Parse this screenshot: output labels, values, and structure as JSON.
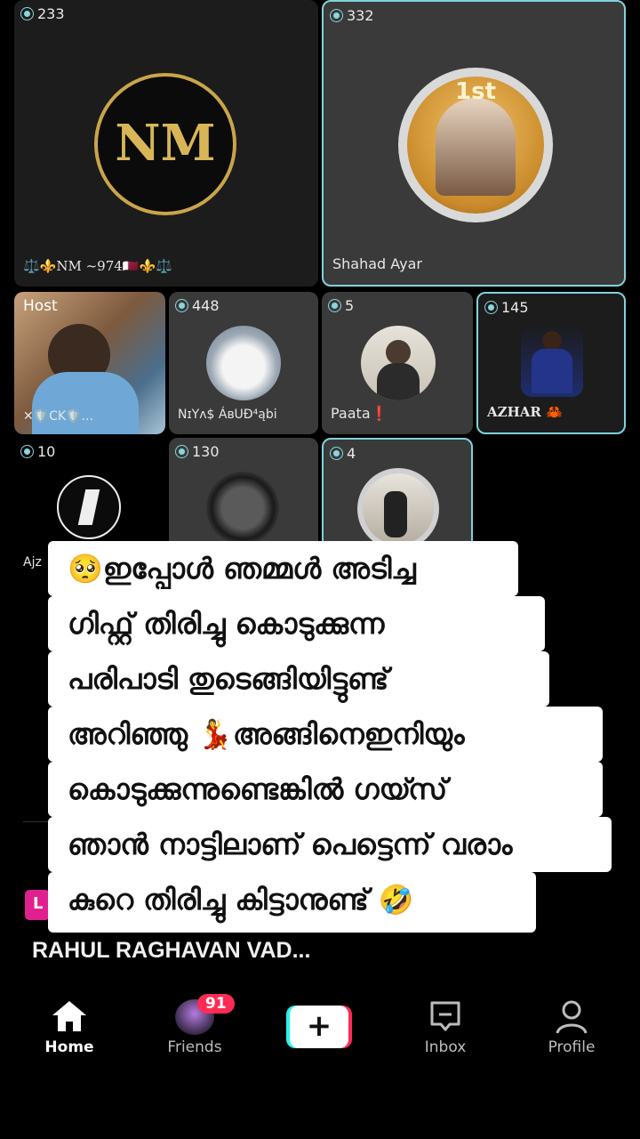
{
  "tiles": [
    {
      "count": "233",
      "name": "⚖️⚜️NM ~974🇶🇦⚜️⚖️",
      "logo_text": "NM"
    },
    {
      "count": "332",
      "name": "Shahad Ayar",
      "frame_text": "1st"
    },
    {
      "host_label": "Host",
      "name": "✕🛡️CK🛡️..."
    },
    {
      "count": "448",
      "name": "NɪYᴧ$ ÁʙUĐ⁴ąbi"
    },
    {
      "count": "5",
      "name": "Paata❗"
    },
    {
      "count": "145",
      "name": "AZHAR 🦀"
    },
    {
      "count": "10",
      "name": "Ajz"
    },
    {
      "count": "130"
    },
    {
      "count": "4"
    }
  ],
  "caption_lines": [
    "🥺ഇപ്പോൾ ഞമ്മൾ അടിച്ച",
    "ഗിഫ്റ്റ് തിരിച്ചു കൊടുക്കുന്ന",
    "പരിപാടി തുടെങ്ങിയിട്ടുണ്ട്",
    "അറിഞ്ഞു 💃അങ്ങിനെഇനിയും",
    "കൊടുക്കുന്നുണ്ടെങ്കിൽ ഗയ്സ്",
    "ഞാൻ നാട്ടിലാണ് പെട്ടെന്ന് വരാം",
    "കുറെ തിരിച്ചു കിട്ടാനുണ്ട് 🤣"
  ],
  "live_badge": "L",
  "stream_title": "RAHUL RAGHAVAN VAD...",
  "nav": {
    "home": "Home",
    "friends": "Friends",
    "friends_badge": "91",
    "create": "+",
    "inbox": "Inbox",
    "profile": "Profile"
  },
  "colors": {
    "accent_border": "#7fd3dc",
    "badge": "#fe2c55",
    "live_pink": "#e0208f"
  },
  "icons": [
    "diamond-icon",
    "home-icon",
    "plus-icon",
    "inbox-icon",
    "profile-icon"
  ]
}
